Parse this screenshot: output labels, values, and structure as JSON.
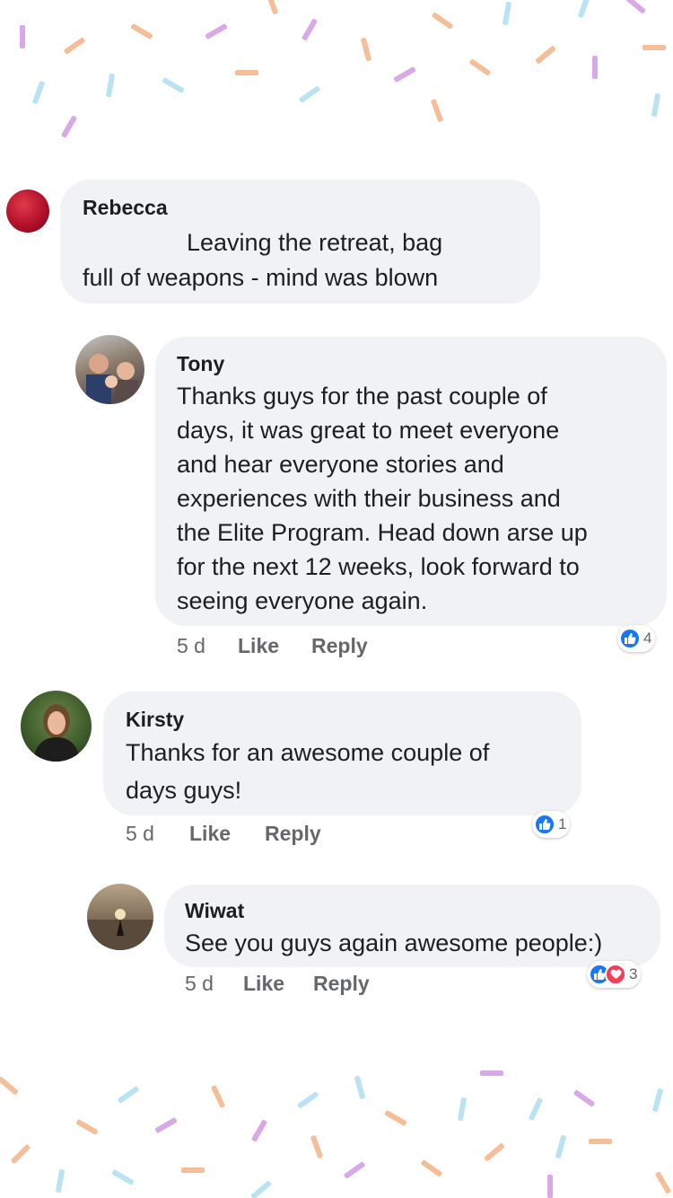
{
  "comments": [
    {
      "name": "Rebecca",
      "lines": [
        "Leaving the retreat, bag",
        "full of weapons - mind was blown"
      ],
      "avatar_icon": "user-avatar"
    },
    {
      "name": "Tony",
      "lines": [
        "Thanks guys for the past couple of",
        "days, it was great to meet everyone",
        "and hear everyone stories and",
        "experiences with their business and",
        "the Elite Program. Head down arse up",
        "for the next 12 weeks, look forward to",
        "seeing everyone again."
      ],
      "time": "5 d",
      "like_label": "Like",
      "reply_label": "Reply",
      "reaction_count": "4",
      "reactions": [
        "like-icon"
      ]
    },
    {
      "name": "Kirsty",
      "lines": [
        "Thanks for an awesome couple of",
        "days guys!"
      ],
      "time": "5 d",
      "like_label": "Like",
      "reply_label": "Reply",
      "reaction_count": "1",
      "reactions": [
        "like-icon"
      ]
    },
    {
      "name": "Wiwat",
      "lines": [
        "See you guys again awesome people:)"
      ],
      "time": "5 d",
      "like_label": "Like",
      "reply_label": "Reply",
      "reaction_count": "3",
      "reactions": [
        "like-icon",
        "heart-icon"
      ]
    }
  ],
  "colors": {
    "bubble": "#f0f2f5",
    "like_blue": "#1877f2",
    "love_red": "#f33e58",
    "confetti": [
      "#f5be98",
      "#d9a8e6",
      "#b9e2f3"
    ]
  }
}
